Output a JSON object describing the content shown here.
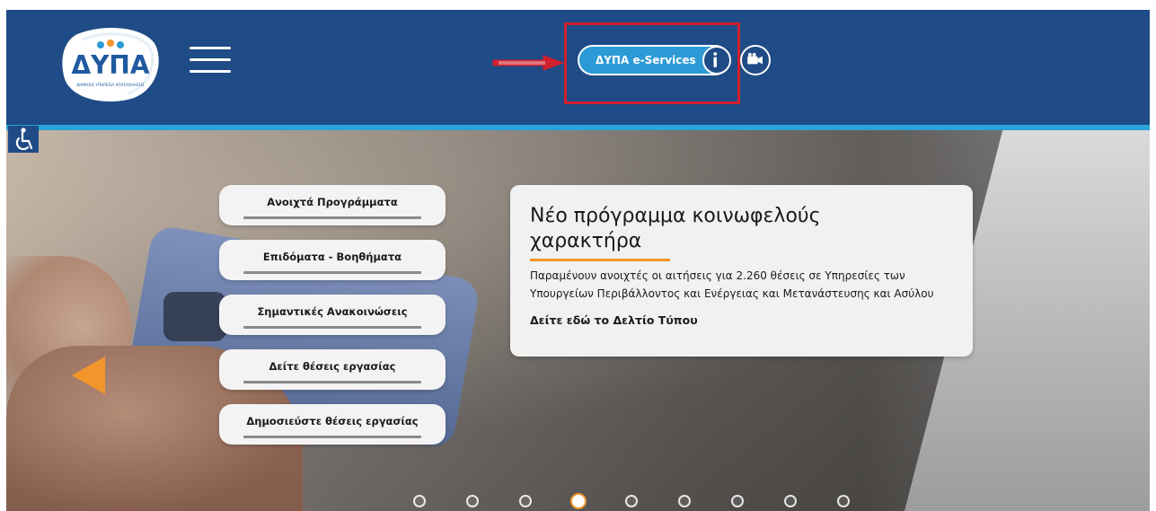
{
  "header": {
    "logo_text": "ΔΥΠΑ",
    "logo_subtext": "ΔΗΜΟΣΙΑ ΥΠΗΡΕΣΙΑ ΑΠΑΣΧΟΛΗΣΗΣ",
    "eservices_label": "ΔΥΠΑ e-Services"
  },
  "quick_links": [
    {
      "label": "Ανοιχτά Προγράμματα"
    },
    {
      "label": "Επιδόματα - Βοηθήματα"
    },
    {
      "label": "Σημαντικές Ανακοινώσεις"
    },
    {
      "label": "Δείτε θέσεις εργασίας"
    },
    {
      "label": "Δημοσιεύστε θέσεις εργασίας"
    }
  ],
  "news": {
    "title": "Νέο πρόγραμμα κοινωφελούς χαρακτήρα",
    "body": "Παραμένουν ανοιχτές οι αιτήσεις για 2.260 θέσεις σε Υπηρεσίες των Υπουργείων Περιβάλλοντος και Ενέργειας και Μετανάστευσης και Ασύλου",
    "link": "Δείτε εδώ το Δελτίο Τύπου"
  },
  "carousel": {
    "slide_count": 9,
    "active_slide": 4
  },
  "colors": {
    "header_bg": "#1f4b86",
    "accent_line": "#29a3d8",
    "eservices_bg": "#2b9ad6",
    "annotation": "#d0202d",
    "orange": "#f2962b"
  },
  "icons": [
    "logo-icon",
    "hamburger-icon",
    "info-icon",
    "video-camera-icon",
    "accessibility-icon",
    "prev-arrow-icon"
  ]
}
